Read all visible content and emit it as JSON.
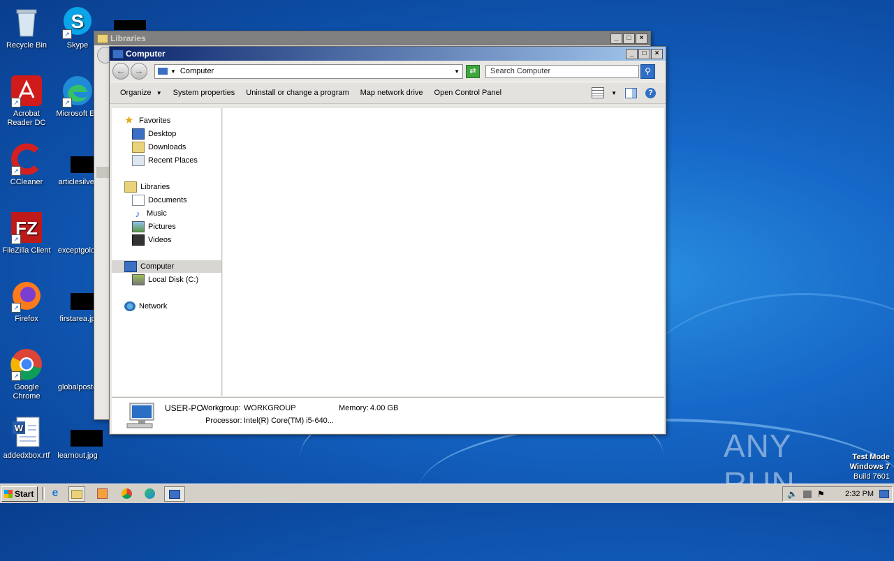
{
  "desktop": {
    "icons": [
      {
        "label": "Recycle Bin"
      },
      {
        "label": "Skype"
      },
      {
        "label": "Acrobat Reader DC"
      },
      {
        "label": "Microsoft Ed"
      },
      {
        "label": "CCleaner"
      },
      {
        "label": "articlesilver"
      },
      {
        "label": "FileZilla Client"
      },
      {
        "label": "exceptgold."
      },
      {
        "label": "Firefox"
      },
      {
        "label": "firstarea.jp"
      },
      {
        "label": "Google Chrome"
      },
      {
        "label": "globalposte"
      },
      {
        "label": "addedxbox.rtf"
      },
      {
        "label": "learnout.jpg"
      }
    ],
    "watermark": {
      "brand": "ANY RUN",
      "mode": "Test Mode",
      "os": "Windows 7",
      "build": "Build 7601"
    }
  },
  "libraries_window": {
    "title": "Libraries"
  },
  "computer_window": {
    "title": "Computer",
    "address": "Computer",
    "search_placeholder": "Search Computer",
    "commands": {
      "organize": "Organize",
      "system_properties": "System properties",
      "uninstall": "Uninstall or change a program",
      "map_drive": "Map network drive",
      "control_panel": "Open Control Panel"
    },
    "nav": {
      "favorites": "Favorites",
      "desktop": "Desktop",
      "downloads": "Downloads",
      "recent": "Recent Places",
      "libraries": "Libraries",
      "documents": "Documents",
      "music": "Music",
      "pictures": "Pictures",
      "videos": "Videos",
      "computer": "Computer",
      "local_disk": "Local Disk (C:)",
      "network": "Network"
    },
    "details": {
      "name": "USER-PC",
      "workgroup_label": "Workgroup:",
      "workgroup_value": "WORKGROUP",
      "memory_label": "Memory:",
      "memory_value": "4.00 GB",
      "processor_label": "Processor:",
      "processor_value": "Intel(R) Core(TM) i5-640..."
    }
  },
  "taskbar": {
    "start_label": "Start",
    "clock": "2:32 PM"
  },
  "colors": {
    "title_active_start": "#0a246a",
    "title_active_end": "#a6caf0",
    "title_inactive": "#808080"
  }
}
